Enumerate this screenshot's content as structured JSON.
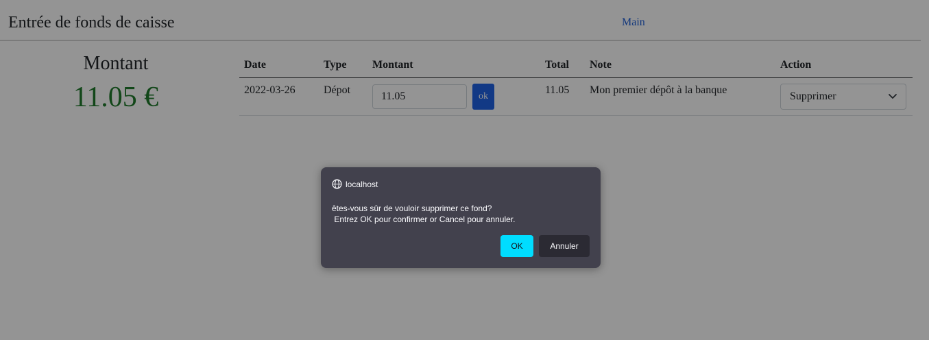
{
  "header": {
    "title": "Entrée de fonds de caisse",
    "main_link": "Main"
  },
  "summary": {
    "label": "Montant",
    "value": "11.05 €"
  },
  "table": {
    "columns": {
      "date": "Date",
      "type": "Type",
      "montant": "Montant",
      "total": "Total",
      "note": "Note",
      "action": "Action"
    },
    "rows": [
      {
        "date": "2022-03-26",
        "type": "Dépot",
        "amount_value": "11.05",
        "ok_label": "ok",
        "total": "11.05",
        "note": "Mon premier dépôt à la banque",
        "action_selected": "Supprimer"
      }
    ]
  },
  "dialog": {
    "host": "localhost",
    "message": "êtes-vous sûr de vouloir supprimer ce fond?\n Entrez OK pour confirmer or Cancel pour annuler.",
    "ok_label": "OK",
    "cancel_label": "Annuler"
  },
  "colors": {
    "link": "#1f5fd6",
    "amount_green": "#1f7a2b",
    "ok_button": "#1f63e6",
    "dialog_bg": "#42414d",
    "dialog_ok": "#00ddff"
  },
  "icons": {
    "dialog_host": "globe-icon",
    "select": "chevron-down-icon"
  }
}
